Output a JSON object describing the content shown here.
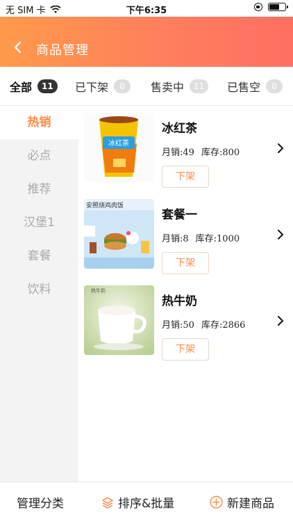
{
  "status": {
    "carrier": "无 SIM 卡",
    "time": "下午6:35"
  },
  "header": {
    "title": "商品管理"
  },
  "tabs": [
    {
      "label": "全部",
      "count": "11",
      "active": true
    },
    {
      "label": "已下架",
      "count": "0"
    },
    {
      "label": "售卖中",
      "count": "11"
    },
    {
      "label": "已售空",
      "count": "0"
    }
  ],
  "sidebar": {
    "items": [
      {
        "label": "热销",
        "active": true
      },
      {
        "label": "必点"
      },
      {
        "label": "推荐"
      },
      {
        "label": "汉堡1"
      },
      {
        "label": "套餐"
      },
      {
        "label": "饮料"
      }
    ]
  },
  "products": [
    {
      "name": "冰红茶",
      "sales": "月销:49",
      "stock": "库存:800",
      "action": "下架",
      "thumb_text": "冰红茶"
    },
    {
      "name": "套餐一",
      "sales": "月销:8",
      "stock": "库存:1000",
      "action": "下架",
      "thumb_text": "安照烧鸡肉饭"
    },
    {
      "name": "热牛奶",
      "sales": "月销:50",
      "stock": "库存:2866",
      "action": "下架",
      "thumb_text": "热牛奶"
    }
  ],
  "bottom": {
    "manage": "管理分类",
    "sort": "排序&批量",
    "new": "新建商品"
  },
  "colors": {
    "accent": "#ff8a45",
    "nav_start": "#ff9a4a",
    "nav_end": "#ff6f62"
  }
}
